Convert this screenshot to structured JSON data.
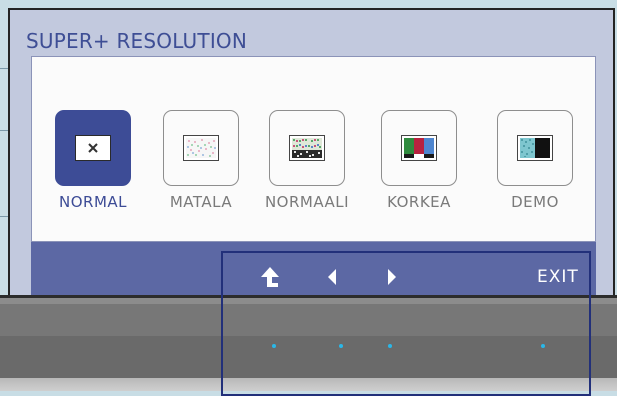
{
  "title": "SUPER+ RESOLUTION",
  "options": [
    {
      "label": "NORMAL",
      "icon": "close-x-icon",
      "selected": true
    },
    {
      "label": "MATALA",
      "icon": "low-resolution-icon",
      "selected": false
    },
    {
      "label": "NORMAALI",
      "icon": "normal-resolution-icon",
      "selected": false
    },
    {
      "label": "KORKEA",
      "icon": "high-resolution-icon",
      "selected": false
    },
    {
      "label": "DEMO",
      "icon": "demo-split-icon",
      "selected": false
    }
  ],
  "buttons": {
    "up": "up-arrow-icon",
    "left": "left-arrow-icon",
    "right": "right-arrow-icon",
    "exit_label": "EXIT"
  },
  "colors": {
    "title": "#3e4e95",
    "selected": "#3d4c96",
    "bar": "#5c68a4",
    "led": "#2ab7e8"
  }
}
